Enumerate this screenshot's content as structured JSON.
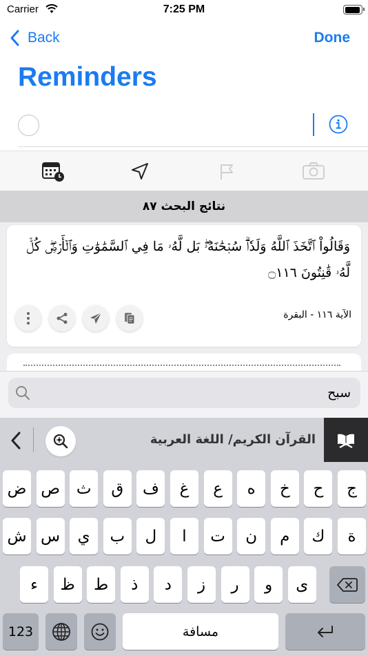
{
  "status_bar": {
    "carrier": "Carrier",
    "time": "7:25 PM"
  },
  "nav": {
    "back_label": "Back",
    "done_label": "Done",
    "title": "Reminders"
  },
  "results": {
    "header": "نتائج البحث ٨٧",
    "card": {
      "verse": "وَقَالُواْ ٱتَّخَذَ ٱللَّهُ وَلَدٗاۗ سُبۡحَٰنَهُۥۖ بَل لَّهُۥ مَا فِي ٱلسَّمَٰوَٰتِ وَٱلۡأَرۡضِۖ كُلّٞ لَّهُۥ قَٰنِتُونَ ۝١١٦",
      "reference": "الآية ١١٦ - البقرة"
    }
  },
  "search": {
    "value": "سبح"
  },
  "keyboard": {
    "source_label": "القرآن الكريم/ اللغة العربية",
    "row1": [
      "ض",
      "ص",
      "ث",
      "ق",
      "ف",
      "غ",
      "ع",
      "ه",
      "خ",
      "ح",
      "ج"
    ],
    "row2": [
      "ش",
      "س",
      "ي",
      "ب",
      "ل",
      "ا",
      "ت",
      "ن",
      "م",
      "ك",
      "ة"
    ],
    "row3": [
      "ء",
      "ظ",
      "ط",
      "ذ",
      "د",
      "ز",
      "ر",
      "و",
      "ى"
    ],
    "numbers_label": "123",
    "space_label": "مسافة"
  },
  "colors": {
    "accent": "#1a7cf0"
  }
}
